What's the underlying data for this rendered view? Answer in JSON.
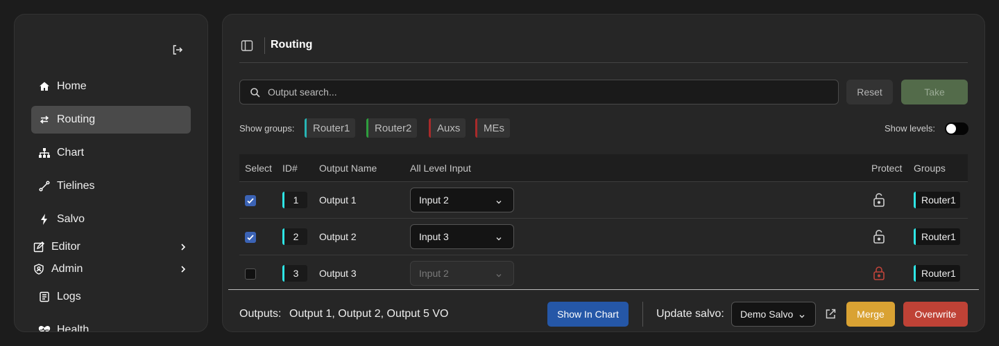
{
  "sidebar": {
    "items": [
      {
        "label": "Home",
        "icon": "home-icon"
      },
      {
        "label": "Routing",
        "icon": "swap-arrows-icon",
        "active": true
      },
      {
        "label": "Chart",
        "icon": "sitemap-icon"
      },
      {
        "label": "Tielines",
        "icon": "tieline-icon"
      },
      {
        "label": "Salvo",
        "icon": "lightning-icon"
      },
      {
        "label": "Editor",
        "icon": "edit-square-icon",
        "expandable": true
      },
      {
        "label": "Admin",
        "icon": "shield-user-icon",
        "expandable": true
      },
      {
        "label": "Logs",
        "icon": "document-icon"
      },
      {
        "label": "Health",
        "icon": "heart-pulse-icon"
      }
    ]
  },
  "header": {
    "title": "Routing"
  },
  "search": {
    "placeholder": "Output search..."
  },
  "actions": {
    "reset": "Reset",
    "take": "Take"
  },
  "groups": {
    "label": "Show groups:",
    "items": [
      {
        "name": "Router1",
        "color": "#27b5b5"
      },
      {
        "name": "Router2",
        "color": "#2e9e3e"
      },
      {
        "name": "Auxs",
        "color": "#a82a2a"
      },
      {
        "name": "MEs",
        "color": "#a82a2a"
      }
    ]
  },
  "levels": {
    "label": "Show levels:",
    "enabled": false
  },
  "table": {
    "columns": [
      "Select",
      "ID#",
      "Output Name",
      "All Level Input",
      "Protect",
      "Groups"
    ],
    "rows": [
      {
        "selected": true,
        "id": "1",
        "name": "Output 1",
        "input": "Input 2",
        "locked": false,
        "group": "Router1"
      },
      {
        "selected": true,
        "id": "2",
        "name": "Output 2",
        "input": "Input 3",
        "locked": false,
        "group": "Router1"
      },
      {
        "selected": false,
        "id": "3",
        "name": "Output 3",
        "input": "Input 2",
        "locked": true,
        "group": "Router1"
      }
    ]
  },
  "footer": {
    "outputs_label": "Outputs:",
    "outputs_value": "Output 1, Output 2, Output 5 VO",
    "show_in_chart": "Show In Chart",
    "update_salvo_label": "Update salvo:",
    "salvo_value": "Demo Salvo",
    "merge": "Merge",
    "overwrite": "Overwrite"
  },
  "colors": {
    "accent_cyan": "#2ee6e6",
    "lock_red": "#c0443a",
    "primary_blue": "#2557a7",
    "merge": "#d9a233",
    "overwrite": "#bf4236"
  }
}
